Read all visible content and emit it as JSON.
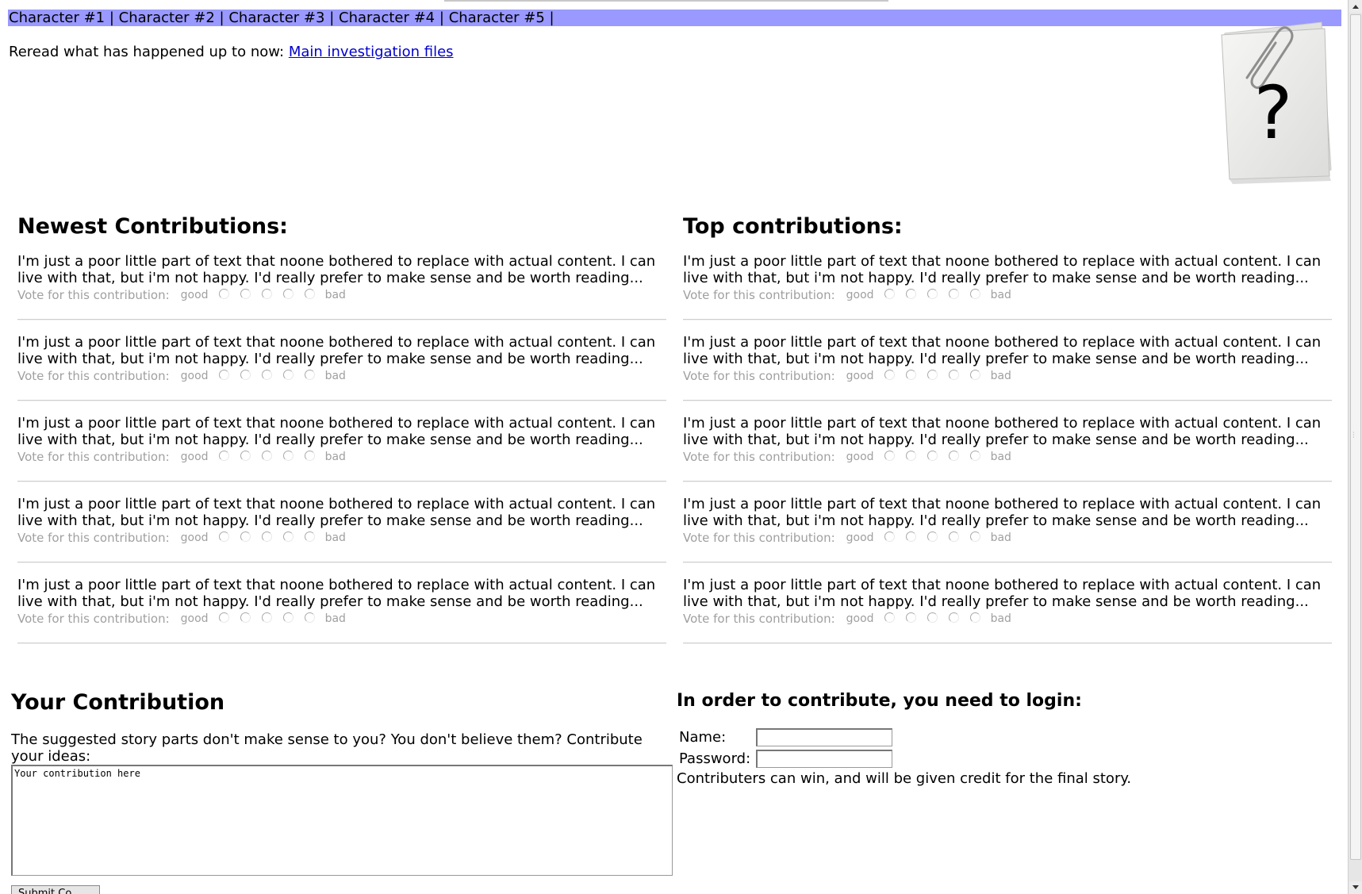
{
  "nav": {
    "items": [
      {
        "label": "Character #1"
      },
      {
        "label": "Character #2"
      },
      {
        "label": "Character #3"
      },
      {
        "label": "Character #4"
      },
      {
        "label": "Character #5"
      }
    ],
    "separator": "|"
  },
  "reread": {
    "text": "Reread what has happened up to now:",
    "link": "Main investigation files"
  },
  "header_icon": {
    "name": "paperclip-question-icon",
    "glyph": "?"
  },
  "newest": {
    "title": "Newest Contributions:",
    "entries": [
      {
        "text": "I'm just a poor little part of text that noone bothered to replace with actual content. I can live with that, but i'm not happy. I'd really prefer to make sense and be worth reading..."
      },
      {
        "text": "I'm just a poor little part of text that noone bothered to replace with actual content. I can live with that, but i'm not happy. I'd really prefer to make sense and be worth reading..."
      },
      {
        "text": "I'm just a poor little part of text that noone bothered to replace with actual content. I can live with that, but i'm not happy. I'd really prefer to make sense and be worth reading..."
      },
      {
        "text": "I'm just a poor little part of text that noone bothered to replace with actual content. I can live with that, but i'm not happy. I'd really prefer to make sense and be worth reading..."
      },
      {
        "text": "I'm just a poor little part of text that noone bothered to replace with actual content. I can live with that, but i'm not happy. I'd really prefer to make sense and be worth reading..."
      }
    ]
  },
  "top": {
    "title": "Top contributions:",
    "entries": [
      {
        "text": "I'm just a poor little part of text that noone bothered to replace with actual content. I can live with that, but i'm not happy. I'd really prefer to make sense and be worth reading..."
      },
      {
        "text": "I'm just a poor little part of text that noone bothered to replace with actual content. I can live with that, but i'm not happy. I'd really prefer to make sense and be worth reading..."
      },
      {
        "text": "I'm just a poor little part of text that noone bothered to replace with actual content. I can live with that, but i'm not happy. I'd really prefer to make sense and be worth reading..."
      },
      {
        "text": "I'm just a poor little part of text that noone bothered to replace with actual content. I can live with that, but i'm not happy. I'd really prefer to make sense and be worth reading..."
      },
      {
        "text": "I'm just a poor little part of text that noone bothered to replace with actual content. I can live with that, but i'm not happy. I'd really prefer to make sense and be worth reading..."
      }
    ]
  },
  "vote": {
    "label": "Vote for this contribution:",
    "good": "good",
    "bad": "bad",
    "options": 5
  },
  "your_contribution": {
    "title": "Your Contribution",
    "prompt": "The suggested story parts don't make sense to you? You don't believe them? Contribute your ideas:",
    "textarea_value": "Your contribution here",
    "submit_label": "Submit Co..."
  },
  "login": {
    "title": "In order to contribute, you need to login:",
    "name_label": "Name:",
    "name_value": "",
    "password_label": "Password:",
    "password_value": "",
    "note": "Contributers can win, and will be given credit for the final story."
  },
  "colors": {
    "nav_bg": "#9999ff",
    "link": "#0000cc",
    "vote_text": "#a0a0a0"
  }
}
